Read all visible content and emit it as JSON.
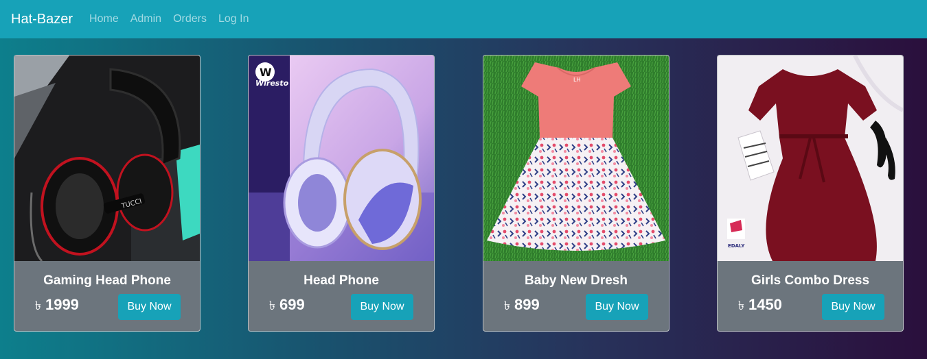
{
  "navbar": {
    "brand": "Hat-Bazer",
    "links": [
      "Home",
      "Admin",
      "Orders",
      "Log In"
    ]
  },
  "products": [
    {
      "name": "Gaming Head Phone",
      "currency": "৳",
      "price": "1999",
      "button": "Buy Now",
      "image": "black-gaming-headphone-photo"
    },
    {
      "name": "Head Phone",
      "currency": "৳",
      "price": "699",
      "button": "Buy Now",
      "image": "lavender-wireless-headphone-photo",
      "image_text": "Wiresto"
    },
    {
      "name": "Baby New Dresh",
      "currency": "৳",
      "price": "899",
      "button": "Buy Now",
      "image": "pink-floral-baby-dress-photo"
    },
    {
      "name": "Girls Combo Dress",
      "currency": "৳",
      "price": "1450",
      "button": "Buy Now",
      "image": "maroon-girls-dress-photo",
      "image_text": "EDALY"
    }
  ],
  "colors": {
    "navbar": "#17a2b8",
    "card_body": "#6c757d",
    "button": "#17a2b8",
    "background_gradient": [
      "#0d7f8c",
      "#2a0f3c"
    ]
  }
}
